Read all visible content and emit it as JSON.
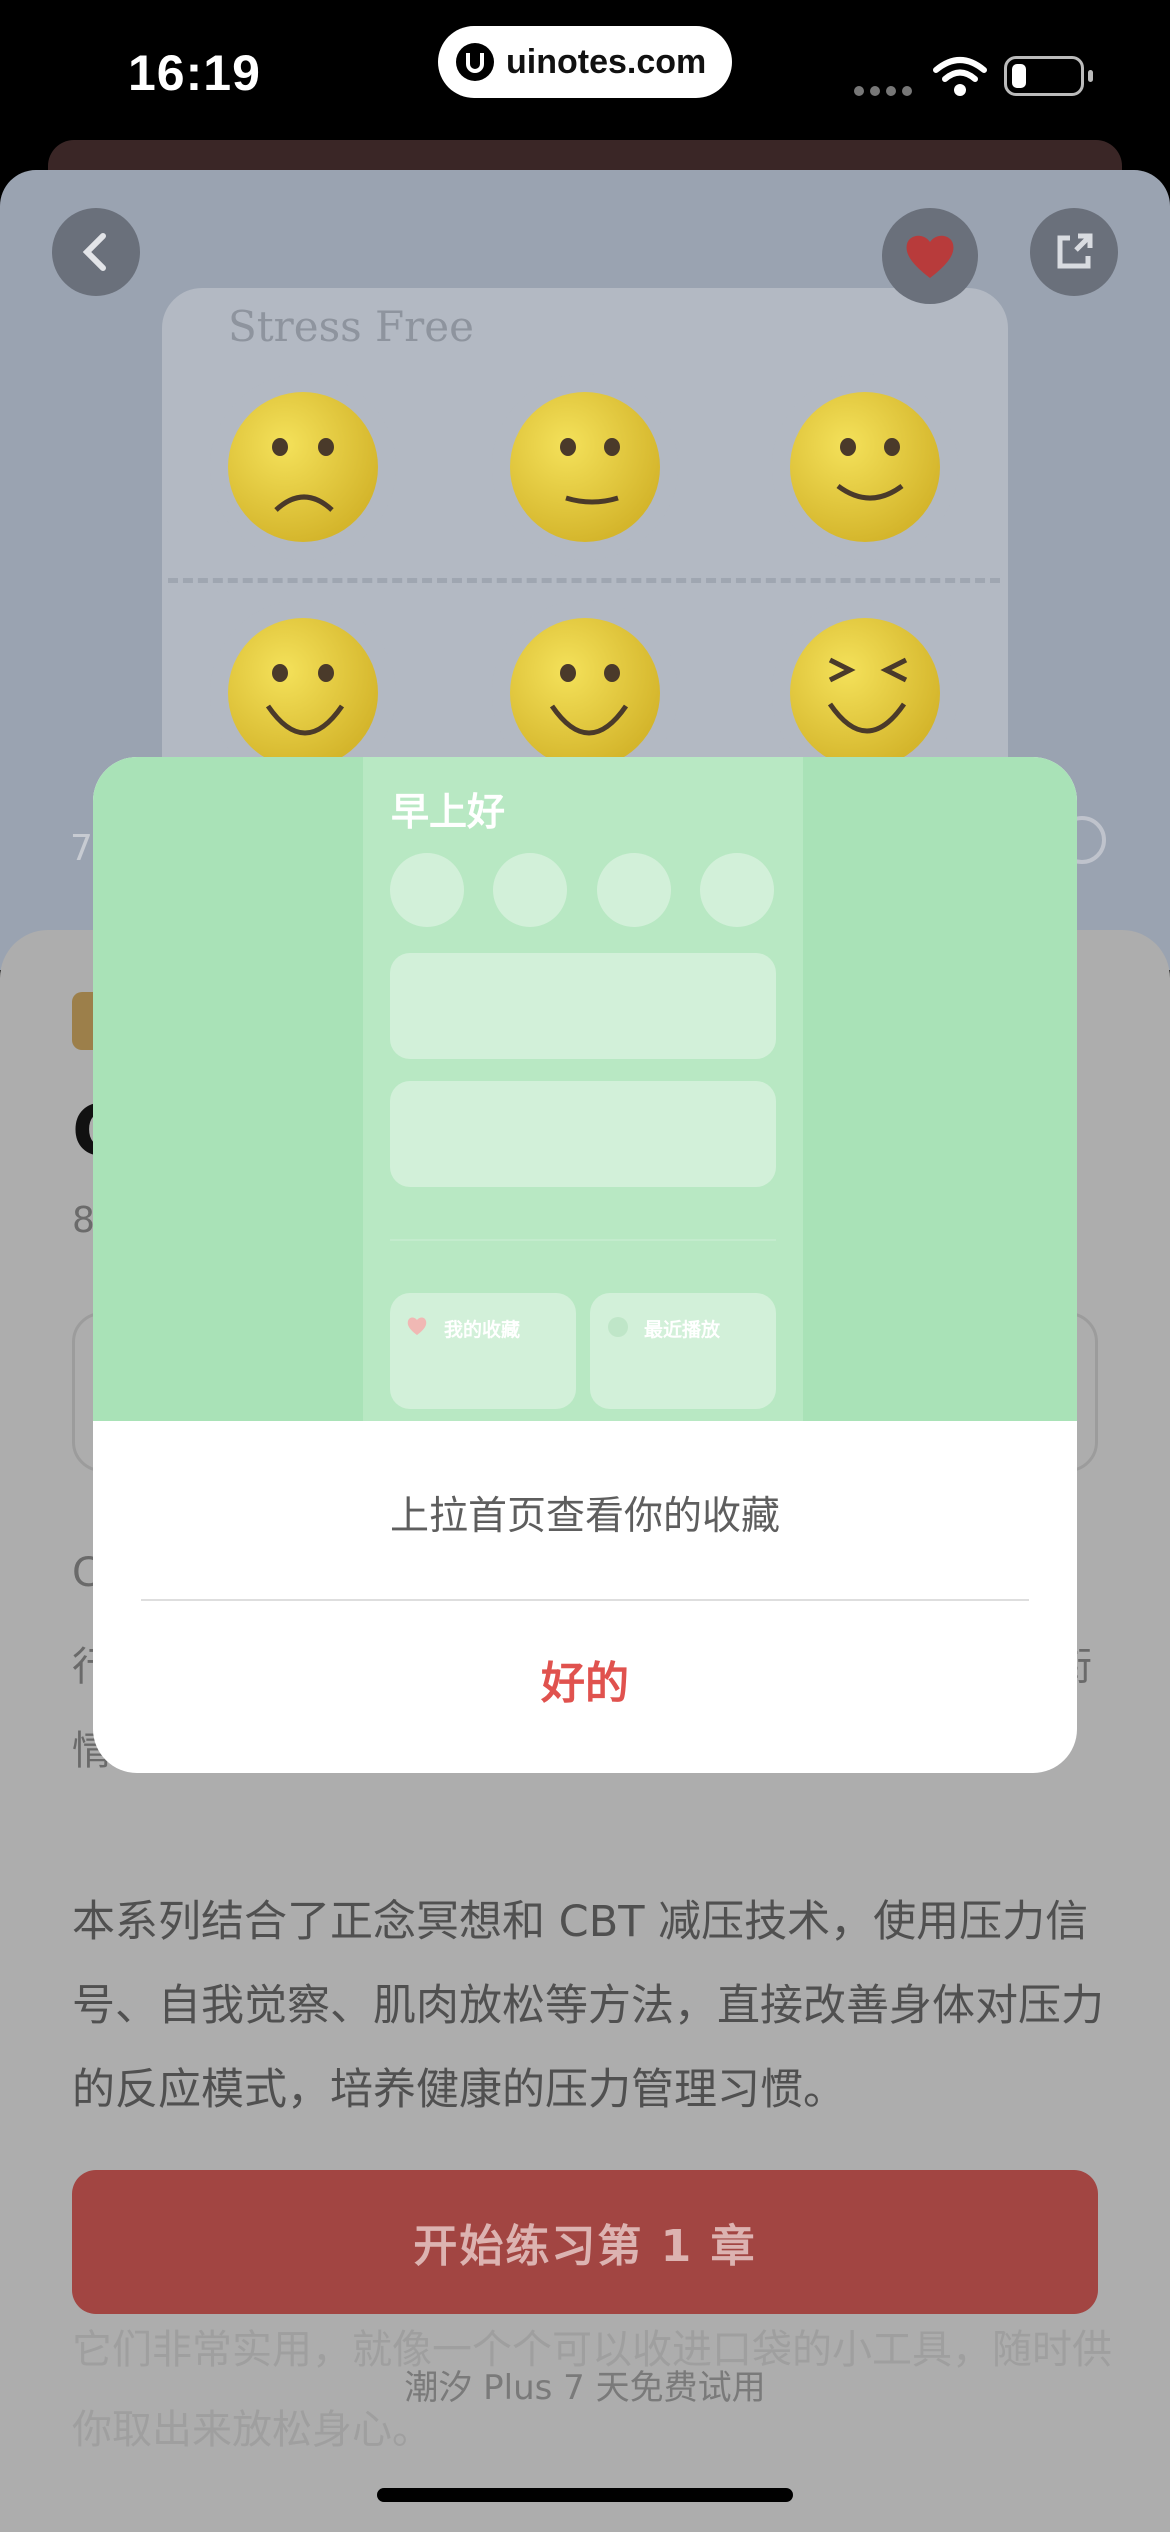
{
  "status_bar": {
    "time": "16:19",
    "site": "uinotes.com",
    "logo_letter": "U"
  },
  "page": {
    "art_title": "Stress Free",
    "side_number": "7",
    "tag_label": "",
    "title_fragment": "C",
    "meta_fragment": "8",
    "para_line1": "C",
    "para_line2": "行",
    "para_line2_end": "衔",
    "para_line3": "情",
    "description": "本系列结合了正念冥想和 CBT 减压技术，使用压力信号、自我觉察、肌肉放松等方法，直接改善身体对压力的反应模式，培养健康的压力管理习惯。",
    "start_button": "开始练习第 1 章",
    "faded_text": "它们非常实用，就像一个个可以收进口袋的小工具，随时供你取出来放松身心。",
    "trial_text": "潮汐 Plus 7 天免费试用"
  },
  "modal": {
    "preview": {
      "greeting": "早上好",
      "favorites_label": "我的收藏",
      "recent_label": "最近播放"
    },
    "message": "上拉首页查看你的收藏",
    "ok_button": "好的"
  },
  "colors": {
    "accent_red": "#e0524e",
    "start_button_bg": "#a24542",
    "modal_hero_green": "#a9e2b7"
  },
  "icons": [
    "back-arrow-icon",
    "heart-icon",
    "share-icon",
    "wifi-icon",
    "battery-icon",
    "globe-icon"
  ]
}
